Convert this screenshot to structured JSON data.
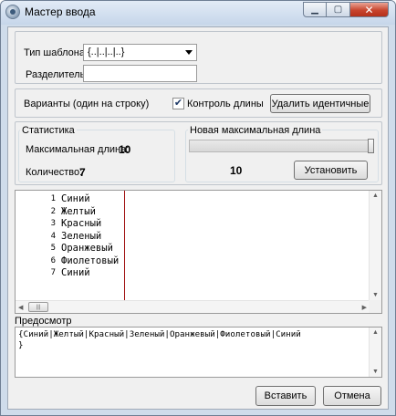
{
  "window": {
    "title": "Мастер ввода",
    "minimize_glyph": "▁",
    "maximize_glyph": "▢",
    "close_glyph": "✕",
    "icon": "app-gear-icon"
  },
  "template": {
    "label": "Тип шаблона",
    "value": "{..|..|..|..}"
  },
  "separator": {
    "label": "Разделитель",
    "value": ""
  },
  "variants": {
    "label": "Варианты (один на строку)",
    "length_control_label": "Контроль длины",
    "length_control_checked": true,
    "remove_duplicates_label": "Удалить идентичные"
  },
  "statistics": {
    "title": "Статистика",
    "max_length_label": "Максимальная длина:",
    "max_length_value": "10",
    "count_label": "Количество:",
    "count_value": "7"
  },
  "new_max": {
    "title": "Новая максимальная длина",
    "value": "10",
    "set_label": "Установить",
    "slider_level": 1.0
  },
  "editor": {
    "lines": [
      {
        "num": "1",
        "text": "Синий"
      },
      {
        "num": "2",
        "text": "Желтый"
      },
      {
        "num": "3",
        "text": "Красный"
      },
      {
        "num": "4",
        "text": "Зеленый"
      },
      {
        "num": "5",
        "text": "Оранжевый"
      },
      {
        "num": "6",
        "text": "Фиолетовый"
      },
      {
        "num": "7",
        "text": "Синий"
      }
    ]
  },
  "preview": {
    "label": "Предосмотр",
    "text_line1": "{Синий|Желтый|Красный|Зеленый|Оранжевый|Фиолетовый|Синий",
    "text_line2": "}"
  },
  "footer": {
    "insert_label": "Вставить",
    "cancel_label": "Отмена"
  },
  "colors": {
    "margin_line": "#a01010",
    "window_frame": "#cfdceb",
    "close_button": "#c8452e"
  }
}
